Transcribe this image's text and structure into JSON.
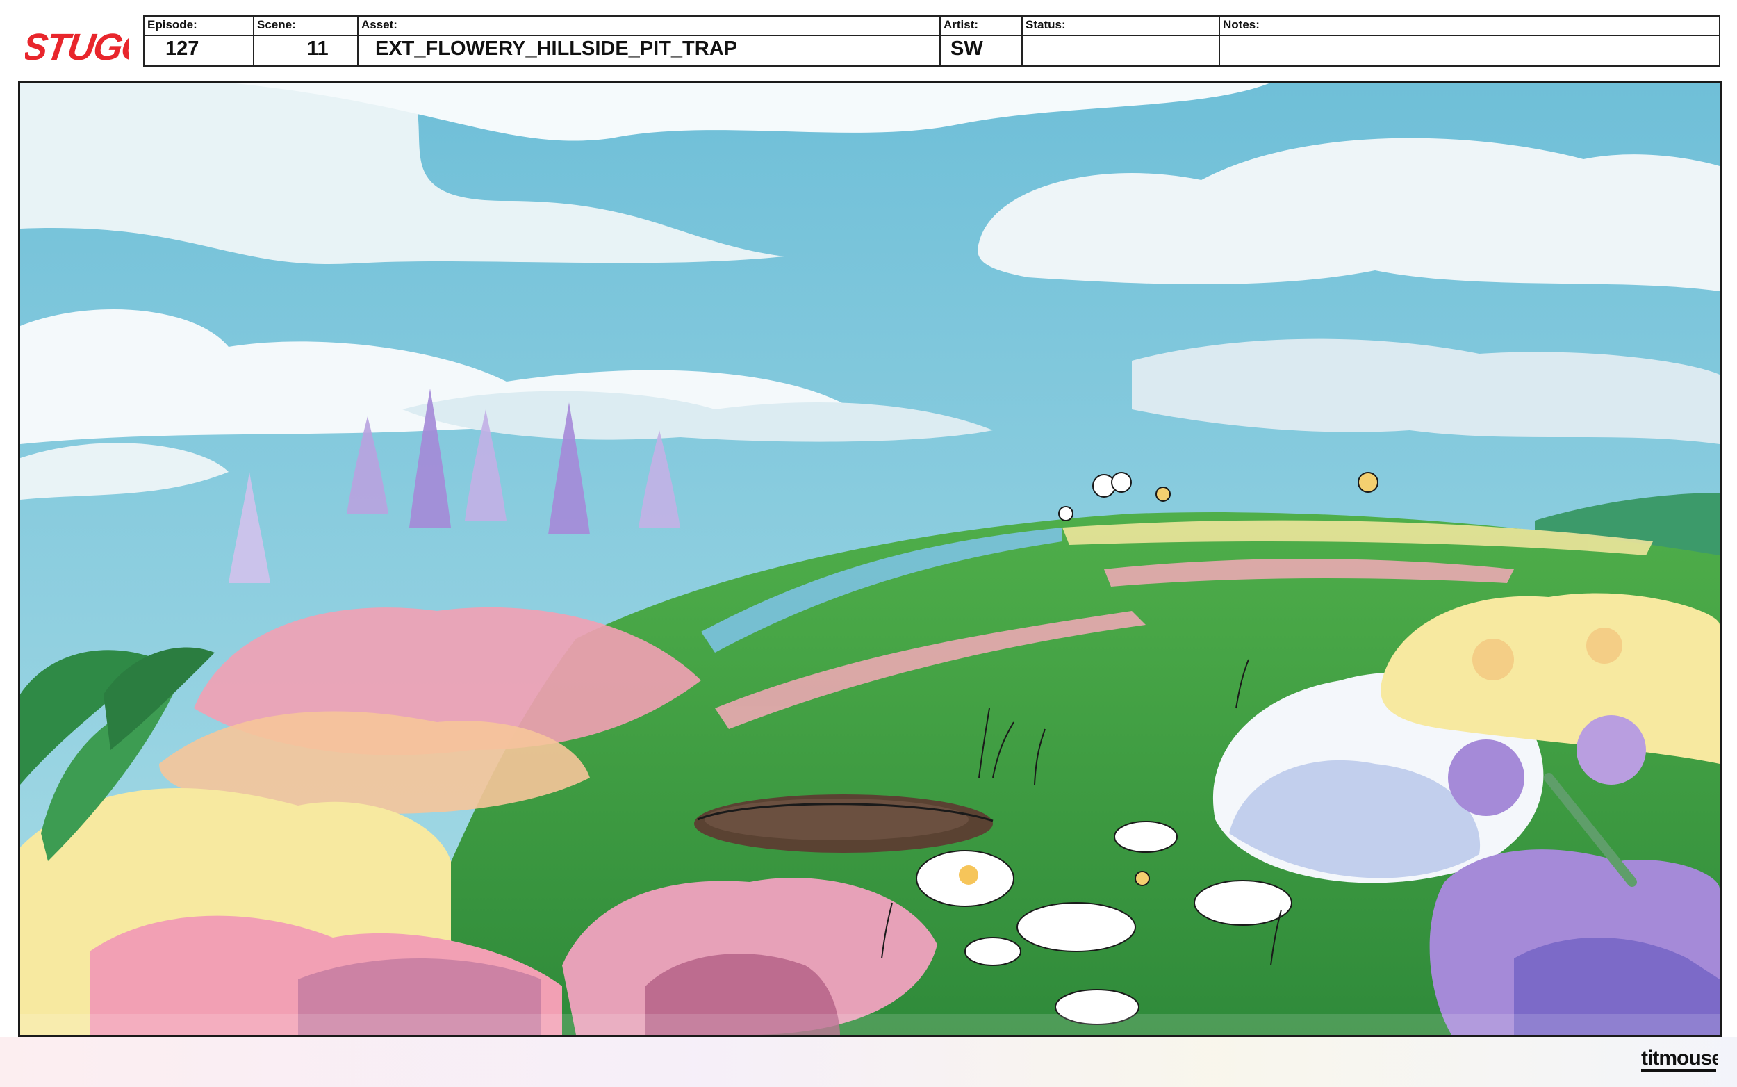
{
  "show_logo": {
    "text": "STUGO",
    "color": "#e8262c"
  },
  "slate": {
    "episode": {
      "label": "Episode:",
      "value": "127"
    },
    "scene": {
      "label": "Scene:",
      "value": "11"
    },
    "asset": {
      "label": "Asset:",
      "value": "EXT_FLOWERY_HILLSIDE_PIT_TRAP"
    },
    "artist": {
      "label": "Artist:",
      "value": "SW"
    },
    "status": {
      "label": "Status:",
      "value": ""
    },
    "notes": {
      "label": "Notes:",
      "value": ""
    }
  },
  "studio_logo": {
    "text": "titmouse"
  },
  "colors": {
    "sky": "#7cc6dc",
    "cloud": "#eef5f8",
    "grass": "#3e9b3e",
    "pit": "#5a4232",
    "flower_pink": "#f2a0b4",
    "flower_purple": "#a58ad8",
    "flower_yellow": "#f7e9a0"
  }
}
